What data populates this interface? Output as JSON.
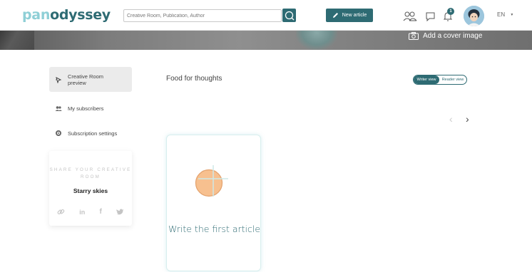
{
  "brand": {
    "part1": "pan",
    "part2": "odyssey"
  },
  "search": {
    "placeholder": "Creative Room, Publication, Author"
  },
  "header": {
    "new_article_label": "New article",
    "notification_count": "1",
    "language": "EN"
  },
  "cover": {
    "add_cover_label": "Add a cover image"
  },
  "sidebar": {
    "items": [
      {
        "label": "Creative Room preview",
        "icon": "pointer-icon",
        "active": true
      },
      {
        "label": "My subscribers",
        "icon": "users-icon",
        "active": false
      },
      {
        "label": "Subscription settings",
        "icon": "gear-icon",
        "active": false
      }
    ],
    "share": {
      "title": "SHARE YOUR CREATIVE ROOM",
      "room_name": "Starry skies",
      "icons": [
        "link-icon",
        "linkedin-icon",
        "facebook-icon",
        "twitter-icon"
      ]
    }
  },
  "main": {
    "section_title": "Food for thoughts",
    "view_toggle": {
      "writer": "Writer view",
      "reader": "Reader view",
      "selected": "Writer view"
    },
    "first_article_label": "Write the first article"
  },
  "colors": {
    "brand_dark": "#2e6b73",
    "brand_light": "#8ecfd6",
    "accent_orange": "#f7c08f"
  }
}
